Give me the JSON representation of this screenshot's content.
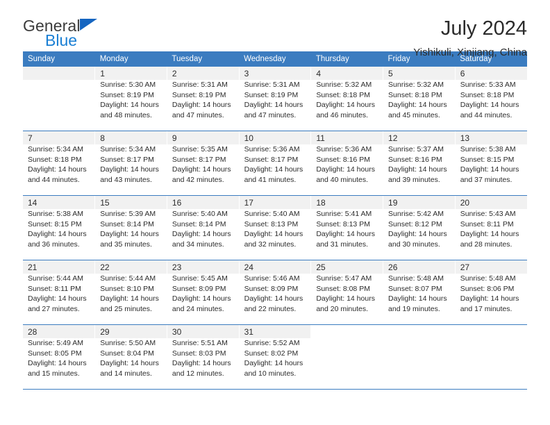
{
  "brand": {
    "name_top": "General",
    "name_bottom": "Blue",
    "triangle_color": "#1565c0",
    "bottom_color": "#1a7fd4"
  },
  "header": {
    "title": "July 2024",
    "subtitle": "Yishikuli, Xinjiang, China"
  },
  "colors": {
    "header_bar": "#3b7cc0",
    "daynum_band": "#f1f1f1",
    "text": "#2b2b2b"
  },
  "weekdays": [
    "Sunday",
    "Monday",
    "Tuesday",
    "Wednesday",
    "Thursday",
    "Friday",
    "Saturday"
  ],
  "labels": {
    "sunrise_prefix": "Sunrise:",
    "sunset_prefix": "Sunset:",
    "daylight_prefix": "Daylight:"
  },
  "weeks": [
    {
      "days": [
        {
          "num": "",
          "sunrise": "",
          "sunset": "",
          "daylight_line1": "",
          "daylight_line2": ""
        },
        {
          "num": "1",
          "sunrise": "Sunrise: 5:30 AM",
          "sunset": "Sunset: 8:19 PM",
          "daylight_line1": "Daylight: 14 hours",
          "daylight_line2": "and 48 minutes."
        },
        {
          "num": "2",
          "sunrise": "Sunrise: 5:31 AM",
          "sunset": "Sunset: 8:19 PM",
          "daylight_line1": "Daylight: 14 hours",
          "daylight_line2": "and 47 minutes."
        },
        {
          "num": "3",
          "sunrise": "Sunrise: 5:31 AM",
          "sunset": "Sunset: 8:19 PM",
          "daylight_line1": "Daylight: 14 hours",
          "daylight_line2": "and 47 minutes."
        },
        {
          "num": "4",
          "sunrise": "Sunrise: 5:32 AM",
          "sunset": "Sunset: 8:18 PM",
          "daylight_line1": "Daylight: 14 hours",
          "daylight_line2": "and 46 minutes."
        },
        {
          "num": "5",
          "sunrise": "Sunrise: 5:32 AM",
          "sunset": "Sunset: 8:18 PM",
          "daylight_line1": "Daylight: 14 hours",
          "daylight_line2": "and 45 minutes."
        },
        {
          "num": "6",
          "sunrise": "Sunrise: 5:33 AM",
          "sunset": "Sunset: 8:18 PM",
          "daylight_line1": "Daylight: 14 hours",
          "daylight_line2": "and 44 minutes."
        }
      ]
    },
    {
      "days": [
        {
          "num": "7",
          "sunrise": "Sunrise: 5:34 AM",
          "sunset": "Sunset: 8:18 PM",
          "daylight_line1": "Daylight: 14 hours",
          "daylight_line2": "and 44 minutes."
        },
        {
          "num": "8",
          "sunrise": "Sunrise: 5:34 AM",
          "sunset": "Sunset: 8:17 PM",
          "daylight_line1": "Daylight: 14 hours",
          "daylight_line2": "and 43 minutes."
        },
        {
          "num": "9",
          "sunrise": "Sunrise: 5:35 AM",
          "sunset": "Sunset: 8:17 PM",
          "daylight_line1": "Daylight: 14 hours",
          "daylight_line2": "and 42 minutes."
        },
        {
          "num": "10",
          "sunrise": "Sunrise: 5:36 AM",
          "sunset": "Sunset: 8:17 PM",
          "daylight_line1": "Daylight: 14 hours",
          "daylight_line2": "and 41 minutes."
        },
        {
          "num": "11",
          "sunrise": "Sunrise: 5:36 AM",
          "sunset": "Sunset: 8:16 PM",
          "daylight_line1": "Daylight: 14 hours",
          "daylight_line2": "and 40 minutes."
        },
        {
          "num": "12",
          "sunrise": "Sunrise: 5:37 AM",
          "sunset": "Sunset: 8:16 PM",
          "daylight_line1": "Daylight: 14 hours",
          "daylight_line2": "and 39 minutes."
        },
        {
          "num": "13",
          "sunrise": "Sunrise: 5:38 AM",
          "sunset": "Sunset: 8:15 PM",
          "daylight_line1": "Daylight: 14 hours",
          "daylight_line2": "and 37 minutes."
        }
      ]
    },
    {
      "days": [
        {
          "num": "14",
          "sunrise": "Sunrise: 5:38 AM",
          "sunset": "Sunset: 8:15 PM",
          "daylight_line1": "Daylight: 14 hours",
          "daylight_line2": "and 36 minutes."
        },
        {
          "num": "15",
          "sunrise": "Sunrise: 5:39 AM",
          "sunset": "Sunset: 8:14 PM",
          "daylight_line1": "Daylight: 14 hours",
          "daylight_line2": "and 35 minutes."
        },
        {
          "num": "16",
          "sunrise": "Sunrise: 5:40 AM",
          "sunset": "Sunset: 8:14 PM",
          "daylight_line1": "Daylight: 14 hours",
          "daylight_line2": "and 34 minutes."
        },
        {
          "num": "17",
          "sunrise": "Sunrise: 5:40 AM",
          "sunset": "Sunset: 8:13 PM",
          "daylight_line1": "Daylight: 14 hours",
          "daylight_line2": "and 32 minutes."
        },
        {
          "num": "18",
          "sunrise": "Sunrise: 5:41 AM",
          "sunset": "Sunset: 8:13 PM",
          "daylight_line1": "Daylight: 14 hours",
          "daylight_line2": "and 31 minutes."
        },
        {
          "num": "19",
          "sunrise": "Sunrise: 5:42 AM",
          "sunset": "Sunset: 8:12 PM",
          "daylight_line1": "Daylight: 14 hours",
          "daylight_line2": "and 30 minutes."
        },
        {
          "num": "20",
          "sunrise": "Sunrise: 5:43 AM",
          "sunset": "Sunset: 8:11 PM",
          "daylight_line1": "Daylight: 14 hours",
          "daylight_line2": "and 28 minutes."
        }
      ]
    },
    {
      "days": [
        {
          "num": "21",
          "sunrise": "Sunrise: 5:44 AM",
          "sunset": "Sunset: 8:11 PM",
          "daylight_line1": "Daylight: 14 hours",
          "daylight_line2": "and 27 minutes."
        },
        {
          "num": "22",
          "sunrise": "Sunrise: 5:44 AM",
          "sunset": "Sunset: 8:10 PM",
          "daylight_line1": "Daylight: 14 hours",
          "daylight_line2": "and 25 minutes."
        },
        {
          "num": "23",
          "sunrise": "Sunrise: 5:45 AM",
          "sunset": "Sunset: 8:09 PM",
          "daylight_line1": "Daylight: 14 hours",
          "daylight_line2": "and 24 minutes."
        },
        {
          "num": "24",
          "sunrise": "Sunrise: 5:46 AM",
          "sunset": "Sunset: 8:09 PM",
          "daylight_line1": "Daylight: 14 hours",
          "daylight_line2": "and 22 minutes."
        },
        {
          "num": "25",
          "sunrise": "Sunrise: 5:47 AM",
          "sunset": "Sunset: 8:08 PM",
          "daylight_line1": "Daylight: 14 hours",
          "daylight_line2": "and 20 minutes."
        },
        {
          "num": "26",
          "sunrise": "Sunrise: 5:48 AM",
          "sunset": "Sunset: 8:07 PM",
          "daylight_line1": "Daylight: 14 hours",
          "daylight_line2": "and 19 minutes."
        },
        {
          "num": "27",
          "sunrise": "Sunrise: 5:48 AM",
          "sunset": "Sunset: 8:06 PM",
          "daylight_line1": "Daylight: 14 hours",
          "daylight_line2": "and 17 minutes."
        }
      ]
    },
    {
      "days": [
        {
          "num": "28",
          "sunrise": "Sunrise: 5:49 AM",
          "sunset": "Sunset: 8:05 PM",
          "daylight_line1": "Daylight: 14 hours",
          "daylight_line2": "and 15 minutes."
        },
        {
          "num": "29",
          "sunrise": "Sunrise: 5:50 AM",
          "sunset": "Sunset: 8:04 PM",
          "daylight_line1": "Daylight: 14 hours",
          "daylight_line2": "and 14 minutes."
        },
        {
          "num": "30",
          "sunrise": "Sunrise: 5:51 AM",
          "sunset": "Sunset: 8:03 PM",
          "daylight_line1": "Daylight: 14 hours",
          "daylight_line2": "and 12 minutes."
        },
        {
          "num": "31",
          "sunrise": "Sunrise: 5:52 AM",
          "sunset": "Sunset: 8:02 PM",
          "daylight_line1": "Daylight: 14 hours",
          "daylight_line2": "and 10 minutes."
        },
        {
          "num": "",
          "sunrise": "",
          "sunset": "",
          "daylight_line1": "",
          "daylight_line2": ""
        },
        {
          "num": "",
          "sunrise": "",
          "sunset": "",
          "daylight_line1": "",
          "daylight_line2": ""
        },
        {
          "num": "",
          "sunrise": "",
          "sunset": "",
          "daylight_line1": "",
          "daylight_line2": ""
        }
      ]
    }
  ]
}
